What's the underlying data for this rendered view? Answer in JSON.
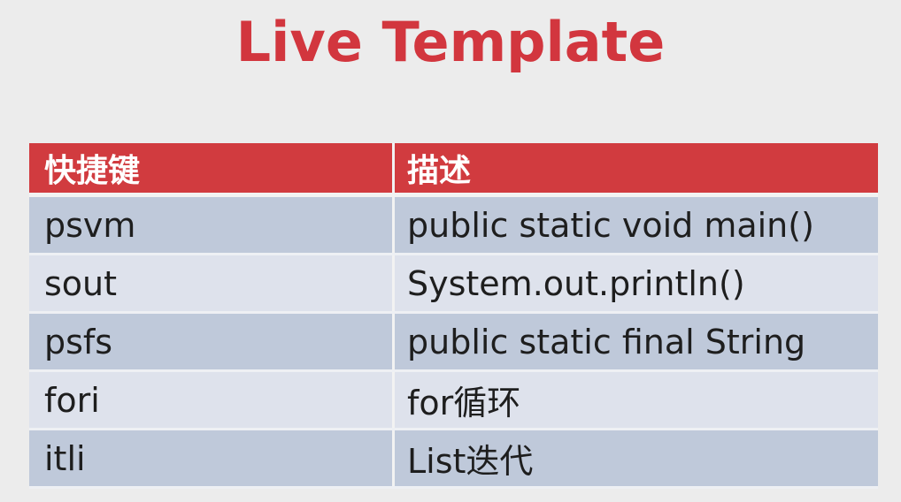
{
  "title": "Live Template",
  "table": {
    "headers": [
      "快捷键",
      "描述"
    ],
    "rows": [
      [
        "psvm",
        "public static void main()"
      ],
      [
        "sout",
        "System.out.println()"
      ],
      [
        "psfs",
        "public static final String"
      ],
      [
        "fori",
        "for循环"
      ],
      [
        "itli",
        "List迭代"
      ]
    ]
  },
  "colors": {
    "title": "#d2363e",
    "header_bg": "#d13b3f",
    "row_dark": "#bfc9da",
    "row_light": "#dee2ec",
    "background": "#ececec"
  }
}
